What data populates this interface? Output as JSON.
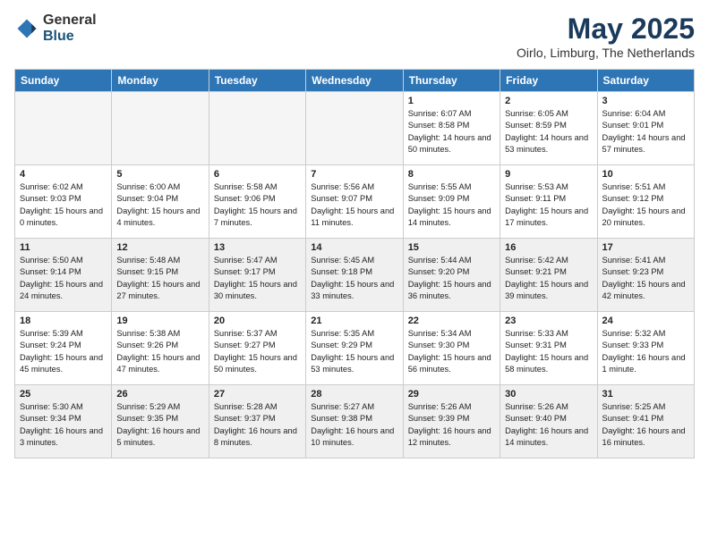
{
  "logo": {
    "general": "General",
    "blue": "Blue",
    "icon": "▶"
  },
  "title": "May 2025",
  "location": "Oirlo, Limburg, The Netherlands",
  "days_of_week": [
    "Sunday",
    "Monday",
    "Tuesday",
    "Wednesday",
    "Thursday",
    "Friday",
    "Saturday"
  ],
  "weeks": [
    [
      {
        "num": "",
        "empty": true
      },
      {
        "num": "",
        "empty": true
      },
      {
        "num": "",
        "empty": true
      },
      {
        "num": "",
        "empty": true
      },
      {
        "num": "1",
        "sunrise": "6:07 AM",
        "sunset": "8:58 PM",
        "daylight": "14 hours and 50 minutes."
      },
      {
        "num": "2",
        "sunrise": "6:05 AM",
        "sunset": "8:59 PM",
        "daylight": "14 hours and 53 minutes."
      },
      {
        "num": "3",
        "sunrise": "6:04 AM",
        "sunset": "9:01 PM",
        "daylight": "14 hours and 57 minutes."
      }
    ],
    [
      {
        "num": "4",
        "sunrise": "6:02 AM",
        "sunset": "9:03 PM",
        "daylight": "15 hours and 0 minutes."
      },
      {
        "num": "5",
        "sunrise": "6:00 AM",
        "sunset": "9:04 PM",
        "daylight": "15 hours and 4 minutes."
      },
      {
        "num": "6",
        "sunrise": "5:58 AM",
        "sunset": "9:06 PM",
        "daylight": "15 hours and 7 minutes."
      },
      {
        "num": "7",
        "sunrise": "5:56 AM",
        "sunset": "9:07 PM",
        "daylight": "15 hours and 11 minutes."
      },
      {
        "num": "8",
        "sunrise": "5:55 AM",
        "sunset": "9:09 PM",
        "daylight": "15 hours and 14 minutes."
      },
      {
        "num": "9",
        "sunrise": "5:53 AM",
        "sunset": "9:11 PM",
        "daylight": "15 hours and 17 minutes."
      },
      {
        "num": "10",
        "sunrise": "5:51 AM",
        "sunset": "9:12 PM",
        "daylight": "15 hours and 20 minutes."
      }
    ],
    [
      {
        "num": "11",
        "sunrise": "5:50 AM",
        "sunset": "9:14 PM",
        "daylight": "15 hours and 24 minutes."
      },
      {
        "num": "12",
        "sunrise": "5:48 AM",
        "sunset": "9:15 PM",
        "daylight": "15 hours and 27 minutes."
      },
      {
        "num": "13",
        "sunrise": "5:47 AM",
        "sunset": "9:17 PM",
        "daylight": "15 hours and 30 minutes."
      },
      {
        "num": "14",
        "sunrise": "5:45 AM",
        "sunset": "9:18 PM",
        "daylight": "15 hours and 33 minutes."
      },
      {
        "num": "15",
        "sunrise": "5:44 AM",
        "sunset": "9:20 PM",
        "daylight": "15 hours and 36 minutes."
      },
      {
        "num": "16",
        "sunrise": "5:42 AM",
        "sunset": "9:21 PM",
        "daylight": "15 hours and 39 minutes."
      },
      {
        "num": "17",
        "sunrise": "5:41 AM",
        "sunset": "9:23 PM",
        "daylight": "15 hours and 42 minutes."
      }
    ],
    [
      {
        "num": "18",
        "sunrise": "5:39 AM",
        "sunset": "9:24 PM",
        "daylight": "15 hours and 45 minutes."
      },
      {
        "num": "19",
        "sunrise": "5:38 AM",
        "sunset": "9:26 PM",
        "daylight": "15 hours and 47 minutes."
      },
      {
        "num": "20",
        "sunrise": "5:37 AM",
        "sunset": "9:27 PM",
        "daylight": "15 hours and 50 minutes."
      },
      {
        "num": "21",
        "sunrise": "5:35 AM",
        "sunset": "9:29 PM",
        "daylight": "15 hours and 53 minutes."
      },
      {
        "num": "22",
        "sunrise": "5:34 AM",
        "sunset": "9:30 PM",
        "daylight": "15 hours and 56 minutes."
      },
      {
        "num": "23",
        "sunrise": "5:33 AM",
        "sunset": "9:31 PM",
        "daylight": "15 hours and 58 minutes."
      },
      {
        "num": "24",
        "sunrise": "5:32 AM",
        "sunset": "9:33 PM",
        "daylight": "16 hours and 1 minute."
      }
    ],
    [
      {
        "num": "25",
        "sunrise": "5:30 AM",
        "sunset": "9:34 PM",
        "daylight": "16 hours and 3 minutes."
      },
      {
        "num": "26",
        "sunrise": "5:29 AM",
        "sunset": "9:35 PM",
        "daylight": "16 hours and 5 minutes."
      },
      {
        "num": "27",
        "sunrise": "5:28 AM",
        "sunset": "9:37 PM",
        "daylight": "16 hours and 8 minutes."
      },
      {
        "num": "28",
        "sunrise": "5:27 AM",
        "sunset": "9:38 PM",
        "daylight": "16 hours and 10 minutes."
      },
      {
        "num": "29",
        "sunrise": "5:26 AM",
        "sunset": "9:39 PM",
        "daylight": "16 hours and 12 minutes."
      },
      {
        "num": "30",
        "sunrise": "5:26 AM",
        "sunset": "9:40 PM",
        "daylight": "16 hours and 14 minutes."
      },
      {
        "num": "31",
        "sunrise": "5:25 AM",
        "sunset": "9:41 PM",
        "daylight": "16 hours and 16 minutes."
      }
    ]
  ]
}
